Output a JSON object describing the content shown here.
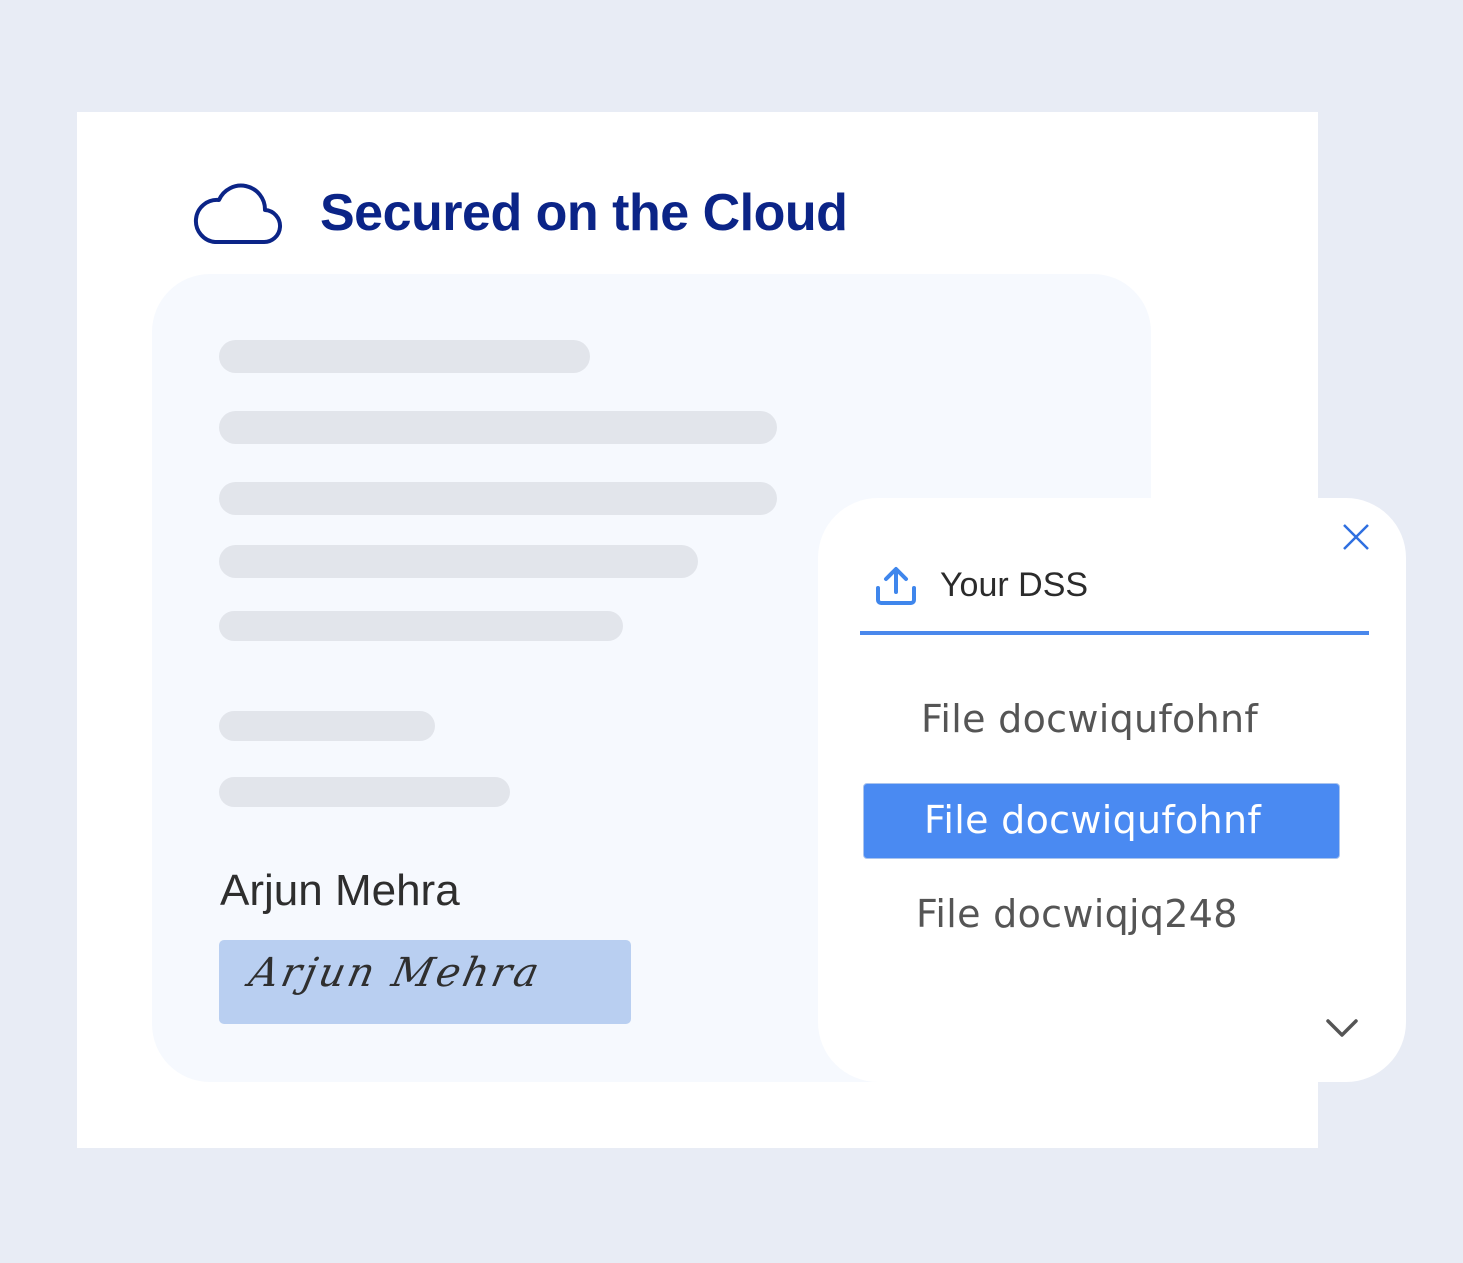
{
  "header": {
    "title": "Secured on the Cloud",
    "icon": "cloud-icon"
  },
  "document": {
    "signer_name": "Arjun Mehra",
    "signature_text": "Arjun Mehra"
  },
  "panel": {
    "title": "Your DSS",
    "files": [
      {
        "label": "File docwiqufohnf",
        "selected": false
      },
      {
        "label": "File docwiqufohnf",
        "selected": true
      },
      {
        "label": "File docwiqjq248",
        "selected": false
      }
    ],
    "icons": [
      "upload-icon",
      "close-icon",
      "chevron-down-icon"
    ]
  },
  "colors": {
    "background": "#e8ecf5",
    "title": "#0b2487",
    "accent": "#4a88ec",
    "selected": "#4a8af2",
    "signature_box": "#b9cff1"
  }
}
